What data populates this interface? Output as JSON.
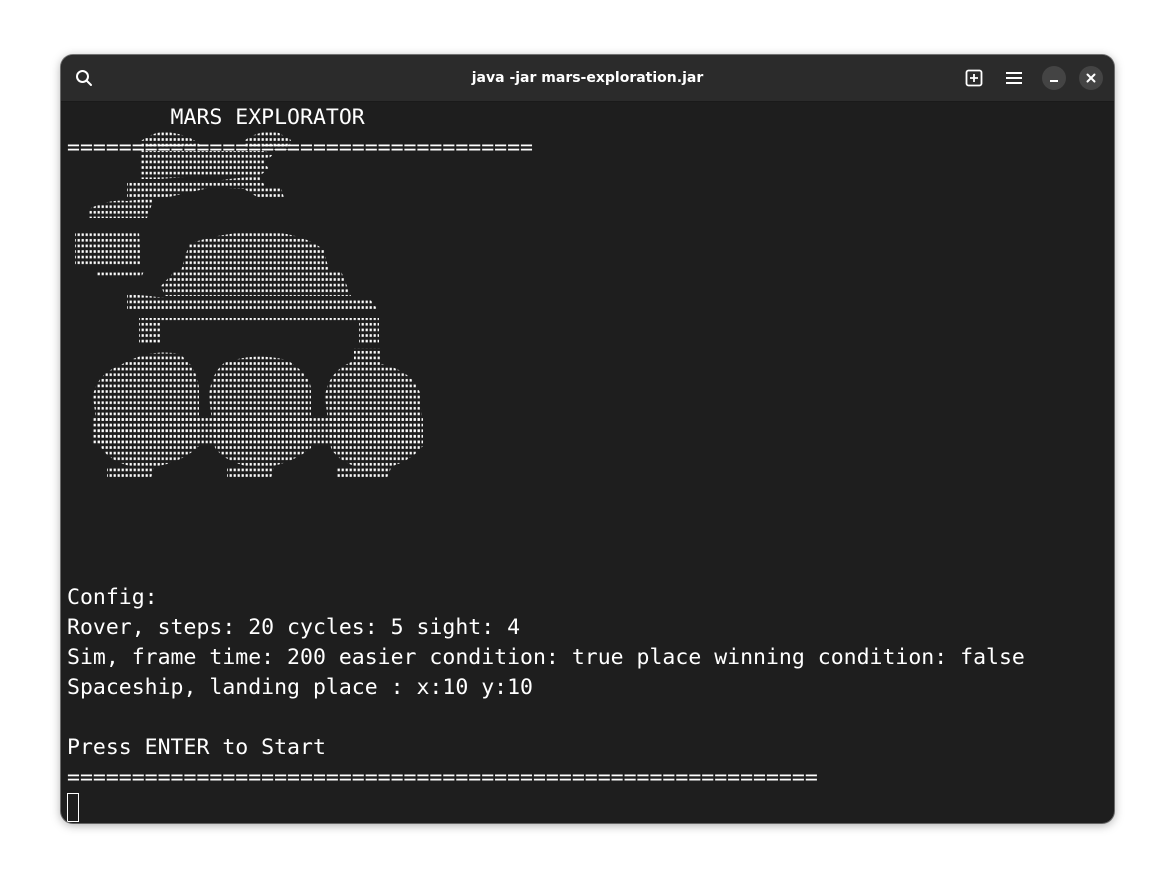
{
  "window": {
    "title": "java -jar mars-exploration.jar"
  },
  "titlebar": {
    "search_icon": "search-icon",
    "new_tab_icon": "new-tab-icon",
    "menu_icon": "hamburger-menu-icon",
    "minimize_icon": "minimize-icon",
    "close_icon": "close-icon"
  },
  "terminal": {
    "heading": "        MARS EXPLORATOR",
    "divider_top": "====================================",
    "ascii_art": "mars-rover-braille-art",
    "config_label": "Config:",
    "rover_line": "Rover, steps: 20 cycles: 5 sight: 4",
    "sim_line": "Sim, frame time: 200 easier condition: true place winning condition: false",
    "spaceship_line": "Spaceship, landing place : x:10 y:10",
    "prompt": "Press ENTER to Start",
    "divider_bottom": "=========================================================="
  },
  "colors": {
    "background": "#1e1e1e",
    "titlebar": "#2b2b2b",
    "text": "#ffffff"
  }
}
